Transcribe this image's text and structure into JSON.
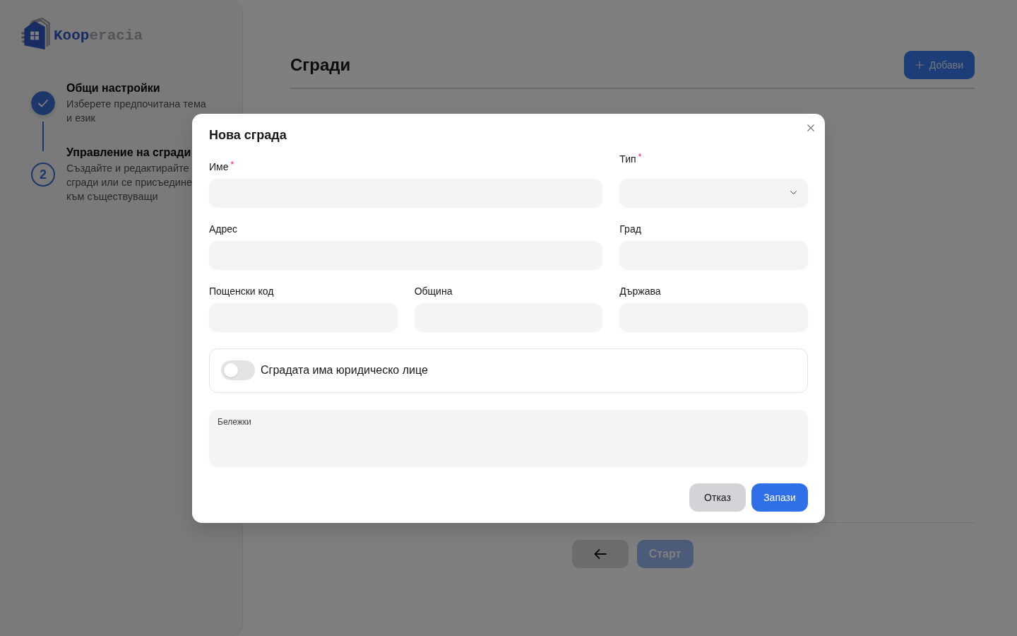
{
  "sidebar": {
    "logo": {
      "accent": "Koop",
      "rest": "eracia"
    },
    "steps": [
      {
        "title": "Общи настройки",
        "description": "Изберете предпочитана тема и език",
        "completed": true
      },
      {
        "number": "2",
        "title": "Управление на сгради",
        "description": "Създайте и редактирайте сгради или се присъедине към съществуващи",
        "completed": false
      }
    ]
  },
  "page": {
    "title": "Сгради",
    "add_button": {
      "label": "Добави"
    },
    "start_button": {
      "label": "Старт",
      "disabled": true
    }
  },
  "modal": {
    "title": "Нова сграда",
    "required_mark": "*",
    "form_rows": [
      [
        {
          "label": "Име",
          "kind": "text",
          "required": true
        },
        {
          "label": "Тип",
          "kind": "select",
          "required": true
        }
      ],
      [
        {
          "label": "Адрес",
          "kind": "text",
          "required": false
        },
        {
          "label": "Град",
          "kind": "text",
          "required": false
        }
      ],
      [
        {
          "label": "Пощенски код",
          "kind": "text",
          "required": false
        },
        {
          "label": "Община",
          "kind": "text",
          "required": false
        },
        {
          "label": "Държава",
          "kind": "text",
          "required": false
        }
      ]
    ],
    "legal_entity_toggle": {
      "label": "Сградата има юридическо лице",
      "on": false
    },
    "notes": {
      "label": "Бележки"
    },
    "buttons": [
      {
        "label": "Отказ",
        "kind": "secondary"
      },
      {
        "label": "Запази",
        "kind": "primary"
      }
    ]
  }
}
